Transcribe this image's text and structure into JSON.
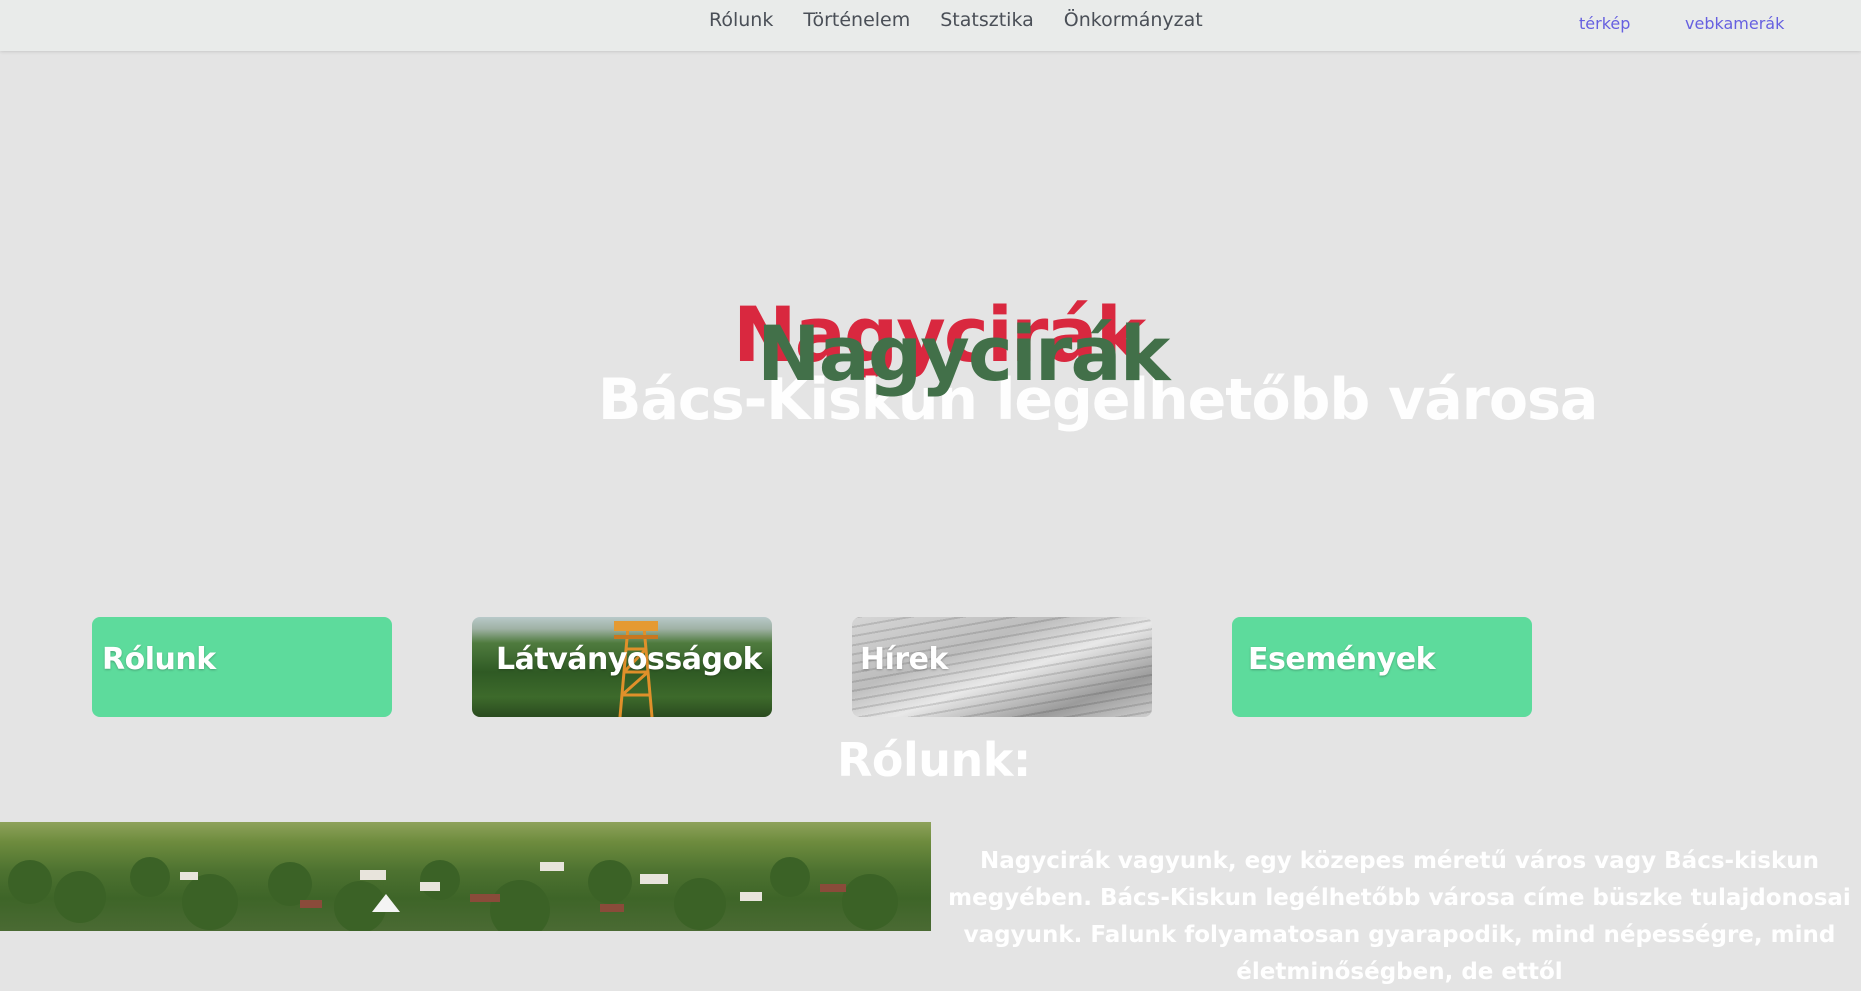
{
  "nav": {
    "items": [
      {
        "label": "Rólunk"
      },
      {
        "label": "Történelem"
      },
      {
        "label": "Statsztika"
      },
      {
        "label": "Önkormányzat"
      }
    ],
    "map_link": "térkép",
    "cam_link": "vebkamerák"
  },
  "hero": {
    "title": "Nagycirák",
    "title_shadow": "Nagycirák",
    "subtitle": "Bács-Kiskun legelhetőbb városa"
  },
  "cards": [
    {
      "label": "Rólunk"
    },
    {
      "label": "Látványosságok"
    },
    {
      "label": "Hírek"
    },
    {
      "label": "Események"
    }
  ],
  "about": {
    "heading": "Rólunk:",
    "text": "Nagycirák vagyunk, egy közepes méretű város vagy Bács-kiskun megyében. Bács-Kiskun legélhetőbb városa címe büszke tulajdonosai vagyunk. Falunk folyamatosan gyarapodik, mind népességre, mind életminőségben, de ettől"
  },
  "colors": {
    "accent_green": "#5ddb9c",
    "title_green": "#427049",
    "title_red": "#d9283f",
    "link_purple": "#6660e0"
  }
}
